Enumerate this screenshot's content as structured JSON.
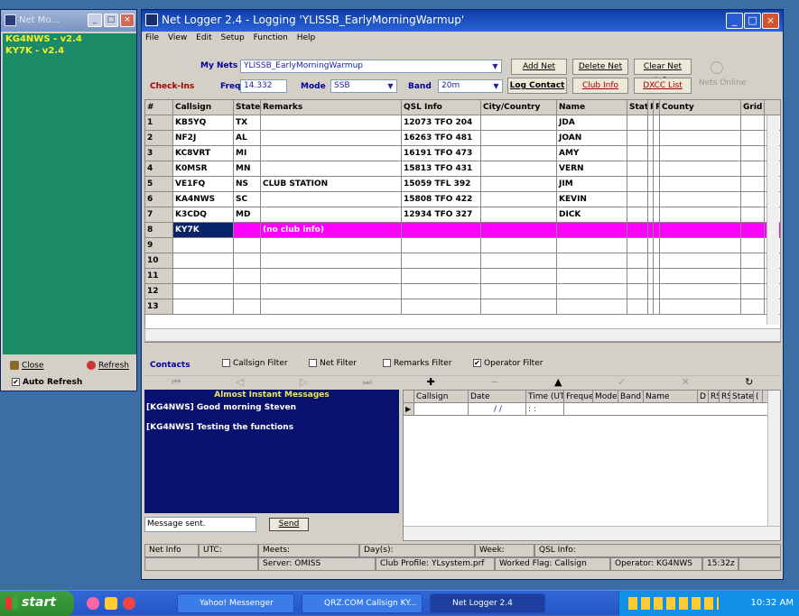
{
  "side": {
    "title": "Net Mo...",
    "items": [
      "KG4NWS - v2.4",
      "KY7K - v2.4"
    ],
    "close": "Close",
    "refresh": "Refresh",
    "auto_refresh": "Auto Refresh"
  },
  "main": {
    "title": "Net Logger 2.4  -  Logging 'YLISSB_EarlyMorningWarmup'",
    "menu": [
      "File",
      "View",
      "Edit",
      "Setup",
      "Function",
      "Help"
    ],
    "my_nets_label": "My Nets",
    "my_nets_value": "YLISSB_EarlyMorningWarmup",
    "add_net": "Add Net",
    "delete_net": "Delete Net",
    "clear_net_info": "Clear Net Info",
    "nets_online": "Nets Online",
    "checkins": "Check-Ins",
    "freq_label": "Freq",
    "freq": "14.332",
    "mode_label": "Mode",
    "mode": "SSB",
    "band_label": "Band",
    "band": "20m",
    "log_contact": "Log Contact",
    "club_info": "Club Info",
    "dxcc_list": "DXCC List"
  },
  "grid": {
    "headers": [
      "#",
      "Callsign",
      "State",
      "Remarks",
      "QSL Info",
      "City/Country",
      "Name",
      "Status",
      "R",
      "R",
      "County",
      "Grid"
    ],
    "rows": [
      [
        "1",
        "KB5YQ",
        "TX",
        "",
        "12073 TFO 204",
        "",
        "JDA"
      ],
      [
        "2",
        "NF2J",
        "AL",
        "",
        "16263 TFO 481",
        "",
        "JOAN"
      ],
      [
        "3",
        "KC8VRT",
        "MI",
        "",
        "16191 TFO 473",
        "",
        "AMY"
      ],
      [
        "4",
        "K0MSR",
        "MN",
        "",
        "15813 TFO 431",
        "",
        "VERN"
      ],
      [
        "5",
        "VE1FQ",
        "NS",
        "CLUB STATION",
        "15059 TFL 392",
        "",
        "JIM"
      ],
      [
        "6",
        "KA4NWS",
        "SC",
        "",
        "15808 TFO 422",
        "",
        "KEVIN"
      ],
      [
        "7",
        "K3CDQ",
        "MD",
        "",
        "12934 TFO 327",
        "",
        "DICK"
      ],
      [
        "8",
        "KY7K",
        "",
        "(no club info)",
        "",
        "",
        ""
      ],
      [
        "9",
        "",
        "",
        "",
        "",
        "",
        ""
      ],
      [
        "10",
        "",
        "",
        "",
        "",
        "",
        ""
      ],
      [
        "11",
        "",
        "",
        "",
        "",
        "",
        ""
      ],
      [
        "12",
        "",
        "",
        "",
        "",
        "",
        ""
      ],
      [
        "13",
        "",
        "",
        "",
        "",
        "",
        ""
      ]
    ]
  },
  "contacts": {
    "label": "Contacts",
    "filters": [
      "Callsign Filter",
      "Net Filter",
      "Remarks Filter",
      "Operator Filter"
    ]
  },
  "messages": {
    "header": "Almost Instant Messages",
    "lines": [
      "[KG4NWS] Good morning Steven",
      "[KG4NWS] Testing the functions"
    ],
    "input": "Message sent.",
    "send": "Send"
  },
  "log": {
    "headers": [
      "Callsign",
      "Date",
      "Time (UT",
      "Frequer",
      "Mode",
      "Band",
      "Name",
      "D",
      "RS",
      "RS",
      "State",
      "("
    ],
    "date": "/ /",
    "time": ": :"
  },
  "status": {
    "net_info": "Net Info",
    "utc": "UTC:",
    "meets": "Meets:",
    "days": "Day(s):",
    "week": "Week:",
    "qsl": "QSL Info:",
    "server": "Server: OMISS",
    "club": "Club Profile: YLsystem.prf",
    "worked": "Worked Flag: Callsign",
    "operator": "Operator: KG4NWS",
    "time": "15:32z"
  },
  "taskbar": {
    "start": "start",
    "tasks": [
      "Yahoo! Messenger",
      "QRZ.COM Callsign KY...",
      "Net Logger 2.4"
    ],
    "clock": "10:32 AM"
  },
  "colors": {
    "highlight_row": "#ff00ff",
    "msg_bg": "#08116e",
    "side_bg": "#1b8a67"
  }
}
